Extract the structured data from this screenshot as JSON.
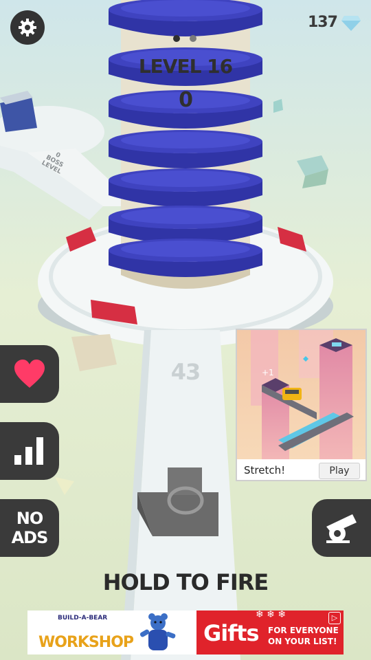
{
  "hud": {
    "gem_count": "137",
    "level_label": "LEVEL 16",
    "score": "0",
    "remaining_shots": "43",
    "hold_to_fire": "HOLD TO FIRE"
  },
  "left_menu": {
    "no_ads_line1": "NO",
    "no_ads_line2": "ADS"
  },
  "sign": {
    "line1": "0",
    "line2": "BOSS",
    "line3": "LEVEL"
  },
  "ad_card": {
    "title": "Stretch!",
    "play_label": "Play",
    "bonus_text": "+1"
  },
  "banner": {
    "brand_top": "BUILD-A-BEAR",
    "brand_main": "WORKSHOP",
    "gifts_word": "Gifts",
    "gifts_line1": "FOR EVERYONE",
    "gifts_line2": "ON YOUR LIST!"
  },
  "colors": {
    "tower_ring": "#3f43c0",
    "tower_core": "#e8e2cf",
    "platform": "#f3f6f6",
    "target_red": "#d62f43",
    "button_dark": "#3a3a3a",
    "heart": "#ff3b67",
    "gem": "#8fd0e8",
    "banner_red": "#e0232b"
  }
}
